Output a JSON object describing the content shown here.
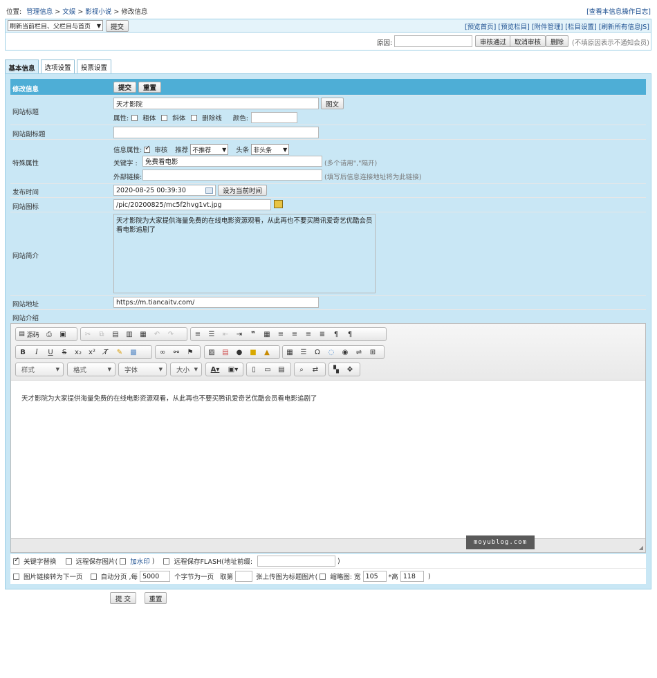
{
  "breadcrumb": {
    "prefix": "位置:",
    "items": [
      "管理信息",
      "文娱",
      "影视小说",
      "修改信息"
    ],
    "sep": ">"
  },
  "top_right_link": "[查看本信息操作日志]",
  "toolbar": {
    "refresh_select": "刷新当前栏目、父栏目与首页",
    "submit": "提交",
    "links": [
      "[预览首页]",
      "[预览栏目]",
      "[附件管理]",
      "[栏目设置]",
      "[刷新所有信息JS]"
    ]
  },
  "review": {
    "reason_label": "原因:",
    "approve": "审核通过",
    "cancel": "取消审核",
    "delete": "删除",
    "note": "(不填原因表示不通知会员)"
  },
  "tabs": [
    "基本信息",
    "选项设置",
    "投票设置"
  ],
  "form": {
    "header": {
      "label": "修改信息",
      "submit": "提交",
      "reset": "重置"
    },
    "title": {
      "label": "网站标题",
      "value": "天才影院",
      "btn": "图文",
      "attr_label": "属性:",
      "bold": "粗体",
      "italic": "斜体",
      "strike": "删除线",
      "color_label": "颜色:"
    },
    "subtitle": {
      "label": "网站副标题",
      "value": ""
    },
    "special": {
      "label": "特殊属性",
      "info_attr": "信息属性:",
      "review": "审核",
      "recommend_label": "推荐",
      "recommend_value": "不推荐",
      "headline_label": "头条",
      "headline_value": "非头条",
      "keyword_label": "关键字  :",
      "keyword_value": "免费看电影",
      "keyword_hint": "(多个请用\",\"隔开)",
      "link_label": "外部链接:",
      "link_value": "",
      "link_hint": "(填写后信息连接地址将为此链接)"
    },
    "pubtime": {
      "label": "发布时间",
      "value": "2020-08-25 00:39:30",
      "btn": "设为当前时间"
    },
    "icon": {
      "label": "网站图标",
      "value": "/pic/20200825/mc5f2hvg1vt.jpg"
    },
    "intro": {
      "label": "网站简介",
      "value": "天才影院为大家提供海量免费的在线电影资源观看，从此再也不要买腾讯爱奇艺优酷会员看电影追剧了"
    },
    "url": {
      "label": "网站地址",
      "value": "https://m.tiancaitv.com/"
    },
    "content_label": "网站介绍"
  },
  "editor": {
    "source_label": "源码",
    "combos": [
      "样式",
      "格式",
      "字体",
      "大小"
    ],
    "content": "天才影院为大家提供海量免费的在线电影资源观看，从此再也不要买腾讯爱奇艺优酷会员看电影追剧了"
  },
  "watermark": "moyublog.com",
  "options": {
    "row1": {
      "keyword_replace": "关键字替换",
      "remote_save": "远程保存图片(",
      "watermark": "加水印",
      "close1": ")",
      "remote_flash": "远程保存FLASH(地址前缀:",
      "close2": ")"
    },
    "row2": {
      "img_link": "图片链接转为下一页",
      "auto_page": "自动分页 ,每",
      "page_chars": "5000",
      "per_page": "个字节为一页",
      "take": "取第",
      "take_value": "",
      "as_title": "张上传图为标题图片(",
      "thumb": "缩略图: 宽",
      "width": "105",
      "height_label": "*高",
      "height": "118",
      "close": ")"
    }
  },
  "bottom": {
    "submit": "提 交",
    "reset": "重置"
  }
}
